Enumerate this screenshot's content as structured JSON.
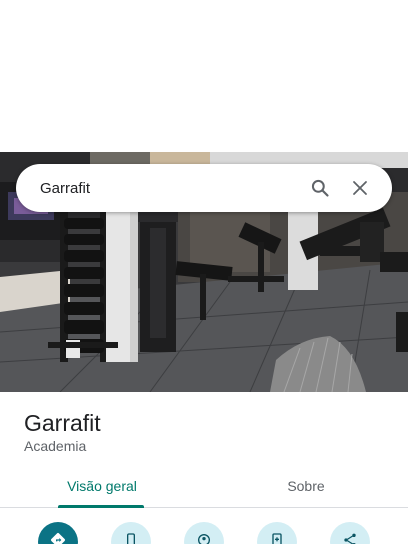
{
  "search": {
    "query": "Garrafit"
  },
  "place": {
    "name": "Garrafit",
    "category": "Academia"
  },
  "tabs": [
    {
      "label": "Visão geral",
      "selected": true
    },
    {
      "label": "Sobre",
      "selected": false
    }
  ],
  "actions": [
    {
      "icon": "directions-icon"
    },
    {
      "icon": "phone-icon"
    },
    {
      "icon": "street-view-icon"
    },
    {
      "icon": "save-icon"
    },
    {
      "icon": "share-icon"
    }
  ],
  "colors": {
    "accent": "#00796b",
    "action_primary": "#0b7385",
    "action_secondary": "#d3eef4"
  }
}
